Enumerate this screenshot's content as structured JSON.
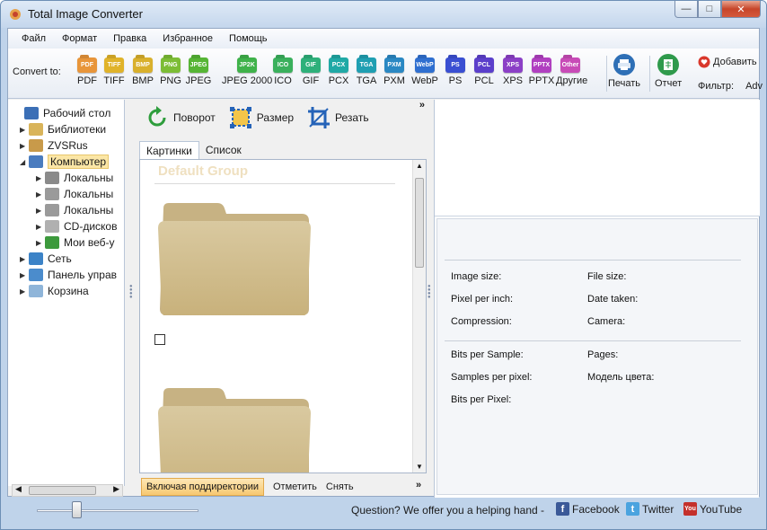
{
  "window": {
    "title": "Total Image Converter"
  },
  "menu": [
    "Файл",
    "Формат",
    "Правка",
    "Избранное",
    "Помощь"
  ],
  "toolbar": {
    "convert_label": "Convert to:",
    "formats": [
      {
        "icon": "PDF",
        "label": "PDF",
        "color": "#e8953a"
      },
      {
        "icon": "TIFF",
        "label": "TIFF",
        "color": "#e0b32a"
      },
      {
        "icon": "BMP",
        "label": "BMP",
        "color": "#d9b02c"
      },
      {
        "icon": "PNG",
        "label": "PNG",
        "color": "#7cbd35"
      },
      {
        "icon": "JPEG",
        "label": "JPEG",
        "color": "#56b535"
      },
      {
        "icon": "JP2K",
        "label": "JPEG 2000",
        "color": "#3fb24a"
      },
      {
        "icon": "ICO",
        "label": "ICO",
        "color": "#3ab05c"
      },
      {
        "icon": "GIF",
        "label": "GIF",
        "color": "#2eb07a"
      },
      {
        "icon": "PCX",
        "label": "PCX",
        "color": "#20a9a6"
      },
      {
        "icon": "TGA",
        "label": "TGA",
        "color": "#1f9fb2"
      },
      {
        "icon": "PXM",
        "label": "PXM",
        "color": "#2a88c3"
      },
      {
        "icon": "WebP",
        "label": "WebP",
        "color": "#2f6fd0"
      },
      {
        "icon": "PS",
        "label": "PS",
        "color": "#3a4fd2"
      },
      {
        "icon": "PCL",
        "label": "PCL",
        "color": "#5b3fcb"
      },
      {
        "icon": "XPS",
        "label": "XPS",
        "color": "#8b3fc6"
      },
      {
        "icon": "PPTX",
        "label": "PPTX",
        "color": "#b03fc0"
      },
      {
        "icon": "Other",
        "label": "Другие",
        "color": "#c84bb7"
      }
    ],
    "print_label": "Печать",
    "report_label": "Отчет",
    "add_label": "Добавить",
    "filter_label": "Фильтр:",
    "filter_value": "Adv"
  },
  "tree": [
    {
      "label": "Рабочий стол",
      "arrow": "",
      "icon_color": "#3b6fb6",
      "icon": "desktop-icon"
    },
    {
      "label": "Библиотеки",
      "arrow": "▶",
      "icon_color": "#d9b45a",
      "icon": "libraries-icon"
    },
    {
      "label": "ZVSRus",
      "arrow": "▶",
      "icon_color": "#c89a4a",
      "icon": "user-folder-icon"
    },
    {
      "label": "Компьютер",
      "arrow": "◢",
      "icon_color": "#4a7cbf",
      "icon": "computer-icon",
      "selected": true
    },
    {
      "label": "Локальны",
      "arrow": "▶",
      "icon_color": "#8a8a8a",
      "icon": "drive-icon"
    },
    {
      "label": "Локальны",
      "arrow": "▶",
      "icon_color": "#9a9a9a",
      "icon": "drive-icon"
    },
    {
      "label": "Локальны",
      "arrow": "▶",
      "icon_color": "#9a9a9a",
      "icon": "drive-icon"
    },
    {
      "label": "CD-дисков",
      "arrow": "▶",
      "icon_color": "#b0b0b0",
      "icon": "cd-drive-icon"
    },
    {
      "label": "Мои веб-у",
      "arrow": "▶",
      "icon_color": "#3d9a3d",
      "icon": "web-icon"
    },
    {
      "label": "Сеть",
      "arrow": "▶",
      "icon_color": "#3c83c7",
      "icon": "network-icon"
    },
    {
      "label": "Панель управ",
      "arrow": "▶",
      "icon_color": "#4b8ccc",
      "icon": "control-panel-icon"
    },
    {
      "label": "Корзина",
      "arrow": "▶",
      "icon_color": "#8fb5d9",
      "icon": "recycle-bin-icon"
    }
  ],
  "actions": {
    "rotate": "Поворот",
    "resize": "Размер",
    "crop": "Резать"
  },
  "tabs": {
    "thumbnails": "Картинки",
    "list": "Список"
  },
  "gallery": {
    "group_title": "Default Group"
  },
  "bottom": {
    "subdirs": "Включая поддиректории",
    "check": "Отметить",
    "uncheck": "Снять"
  },
  "info": {
    "image_size": "Image size:",
    "file_size": "File size:",
    "pixel_per_inch": "Pixel per inch:",
    "date_taken": "Date taken:",
    "compression": "Compression:",
    "camera": "Camera:",
    "bits_per_sample": "Bits per Sample:",
    "pages": "Pages:",
    "samples_per_pixel": "Samples per pixel:",
    "color_model": "Модель цвета:",
    "bits_per_pixel": "Bits per Pixel:"
  },
  "status": {
    "message": "Question? We offer you a helping hand -",
    "facebook": "Facebook",
    "twitter": "Twitter",
    "youtube": "YouTube"
  }
}
